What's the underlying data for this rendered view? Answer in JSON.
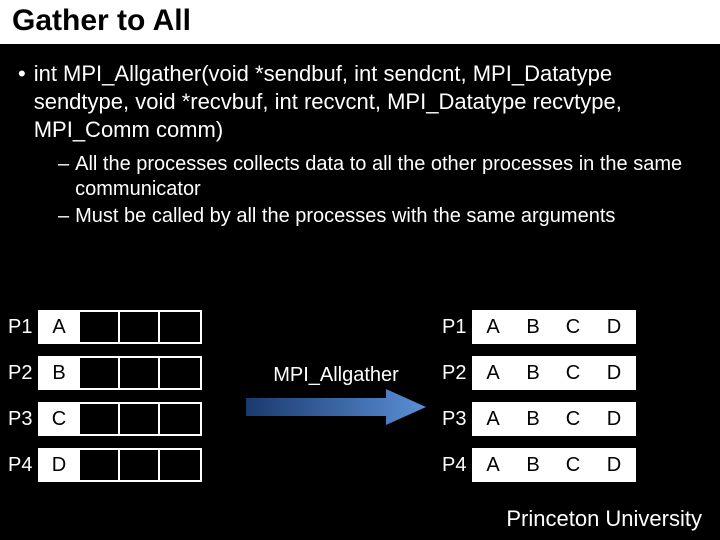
{
  "title": "Gather to All",
  "main_bullet": "int MPI_Allgather(void *sendbuf, int sendcnt, MPI_Datatype sendtype, void *recvbuf, int recvcnt, MPI_Datatype recvtype, MPI_Comm comm)",
  "sub_bullets": [
    "All the processes collects data to all the other processes in the same communicator",
    "Must be called by all the processes with the same arguments"
  ],
  "arrow_label": "MPI_Allgather",
  "left": {
    "rows": [
      {
        "label": "P1",
        "cells": [
          "A",
          "",
          "",
          ""
        ]
      },
      {
        "label": "P2",
        "cells": [
          "B",
          "",
          "",
          ""
        ]
      },
      {
        "label": "P3",
        "cells": [
          "C",
          "",
          "",
          ""
        ]
      },
      {
        "label": "P4",
        "cells": [
          "D",
          "",
          "",
          ""
        ]
      }
    ]
  },
  "right": {
    "rows": [
      {
        "label": "P1",
        "cells": [
          "A",
          "B",
          "C",
          "D"
        ]
      },
      {
        "label": "P2",
        "cells": [
          "A",
          "B",
          "C",
          "D"
        ]
      },
      {
        "label": "P3",
        "cells": [
          "A",
          "B",
          "C",
          "D"
        ]
      },
      {
        "label": "P4",
        "cells": [
          "A",
          "B",
          "C",
          "D"
        ]
      }
    ]
  },
  "footer": "Princeton University"
}
